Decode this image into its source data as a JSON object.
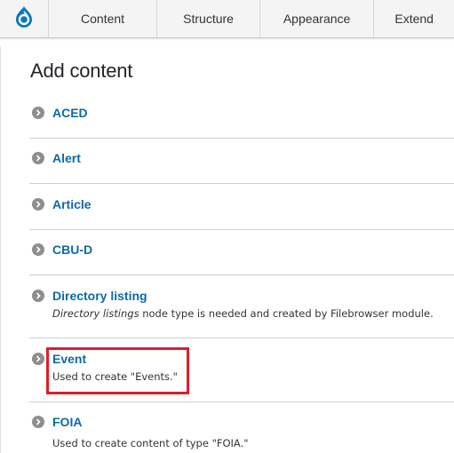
{
  "toolbar": {
    "home_icon": "drupal-drop-icon",
    "tabs": [
      {
        "label": "Content"
      },
      {
        "label": "Structure"
      },
      {
        "label": "Appearance"
      },
      {
        "label": "Extend"
      }
    ]
  },
  "page": {
    "title": "Add content"
  },
  "content_types": [
    {
      "name": "ACED",
      "description": ""
    },
    {
      "name": "Alert",
      "description": ""
    },
    {
      "name": "Article",
      "description": ""
    },
    {
      "name": "CBU-D",
      "description": ""
    },
    {
      "name": "Directory listing",
      "description_em": "Directory listings",
      "description": " node type is needed and created by Filebrowser module."
    },
    {
      "name": "Event",
      "description": "Used to create \"Events.\""
    },
    {
      "name": "FOIA",
      "description": "Used to create content of type \"FOIA.\""
    }
  ],
  "colors": {
    "link": "#0d6aa6",
    "highlight_border": "#d9202b",
    "bullet": "#8e8e8e",
    "drupal_blue": "#0a77bf"
  }
}
